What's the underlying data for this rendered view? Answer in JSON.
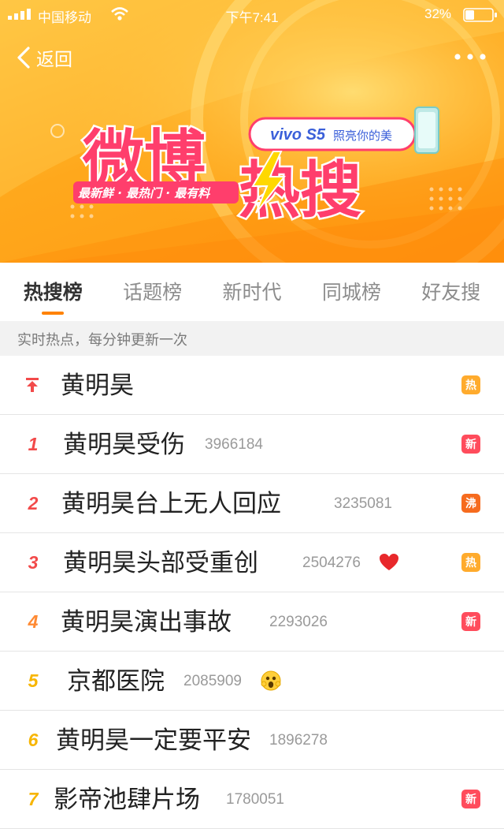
{
  "status_bar": {
    "carrier": "中国移动",
    "time": "下午7:41",
    "battery": "32%"
  },
  "nav": {
    "back_label": "返回"
  },
  "banner": {
    "logo_line1": "微博",
    "logo_line2": "热搜",
    "slogan": "最新鲜 · 最热门 · 最有料",
    "sponsor": "vivo S5",
    "sponsor_tagline": "照亮你的美"
  },
  "tabs": [
    {
      "label": "热搜榜",
      "active": true
    },
    {
      "label": "话题榜",
      "active": false
    },
    {
      "label": "新时代",
      "active": false
    },
    {
      "label": "同城榜",
      "active": false
    },
    {
      "label": "好友搜",
      "active": false
    }
  ],
  "subtitle": "实时热点，每分钟更新一次",
  "list": [
    {
      "rank": "",
      "pinned": true,
      "title": "黄明昊",
      "count": "",
      "badge": "热",
      "badge_type": "hot"
    },
    {
      "rank": "1",
      "title": "黄明昊受伤",
      "count": "3966184",
      "badge": "新",
      "badge_type": "new"
    },
    {
      "rank": "2",
      "title": "黄明昊台上无人回应",
      "count": "3235081",
      "badge": "沸",
      "badge_type": "boil"
    },
    {
      "rank": "3",
      "title": "黄明昊头部受重创",
      "count": "2504276",
      "badge": "热",
      "badge_type": "hot",
      "emoji": "heart-icon"
    },
    {
      "rank": "4",
      "title": "黄明昊演出事故",
      "count": "2293026",
      "badge": "新",
      "badge_type": "new"
    },
    {
      "rank": "5",
      "title": "京都医院",
      "count": "2085909",
      "badge": "",
      "badge_type": "",
      "emoji": "scared-face-icon"
    },
    {
      "rank": "6",
      "title": "黄明昊一定要平安",
      "count": "1896278",
      "badge": "",
      "badge_type": ""
    },
    {
      "rank": "7",
      "title": "影帝池肆片场",
      "count": "1780051",
      "badge": "新",
      "badge_type": "new"
    }
  ],
  "colors": {
    "accent": "#ff8200",
    "rank_top": "#f24a4a",
    "rank_mid": "#ff8a33",
    "rank_low": "#f7b500",
    "badge_hot": "#ffab2d",
    "badge_new": "#ff4c5c",
    "badge_boil": "#f66b1e"
  }
}
